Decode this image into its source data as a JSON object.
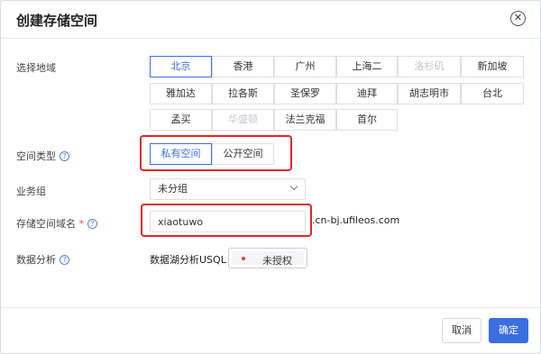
{
  "dialog": {
    "title": "创建存储空间",
    "close_glyph": "✕"
  },
  "region": {
    "label": "选择地域",
    "options": [
      {
        "label": "北京",
        "state": "selected"
      },
      {
        "label": "香港",
        "state": "normal"
      },
      {
        "label": "广州",
        "state": "normal"
      },
      {
        "label": "上海二",
        "state": "normal"
      },
      {
        "label": "洛杉矶",
        "state": "disabled"
      },
      {
        "label": "新加坡",
        "state": "normal"
      },
      {
        "label": "雅加达",
        "state": "normal"
      },
      {
        "label": "拉各斯",
        "state": "normal"
      },
      {
        "label": "圣保罗",
        "state": "normal"
      },
      {
        "label": "迪拜",
        "state": "normal"
      },
      {
        "label": "胡志明市",
        "state": "normal"
      },
      {
        "label": "台北",
        "state": "normal"
      },
      {
        "label": "孟买",
        "state": "normal"
      },
      {
        "label": "华盛顿",
        "state": "disabled"
      },
      {
        "label": "法兰克福",
        "state": "normal"
      },
      {
        "label": "首尔",
        "state": "normal"
      }
    ]
  },
  "space_type": {
    "label": "空间类型",
    "help_glyph": "?",
    "options": [
      {
        "label": "私有空间",
        "state": "selected"
      },
      {
        "label": "公开空间",
        "state": "normal"
      }
    ]
  },
  "business_group": {
    "label": "业务组",
    "selected": "未分组"
  },
  "domain_name": {
    "label": "存储空间域名",
    "required_mark": "*",
    "help_glyph": "?",
    "value": "xiaotuwo",
    "suffix": ".cn-bj.ufileos.com"
  },
  "data_analysis": {
    "label": "数据分析",
    "help_glyph": "?",
    "feature": "数据湖分析USQL",
    "toggle_text": "未授权",
    "toggle_on": false
  },
  "footer": {
    "cancel_label": "取消",
    "ok_label": "确定"
  },
  "colors": {
    "accent": "#3b6fe3",
    "highlight": "#e0262b",
    "primary_button": "#3a6fe0"
  },
  "icons": [
    "close-icon",
    "help-icon",
    "chevron-down-icon",
    "status-dot-icon"
  ]
}
